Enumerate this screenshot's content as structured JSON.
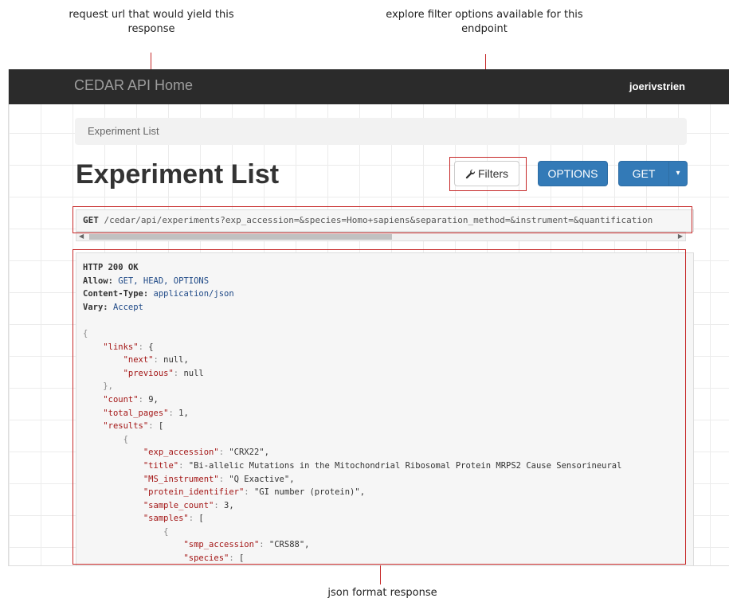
{
  "annotations": {
    "url_callout": "request url that would yield this response",
    "filters_callout": "explore filter options available for this endpoint",
    "json_callout": "json format response"
  },
  "navbar": {
    "brand": "CEDAR API Home",
    "user": "joerivstrien"
  },
  "breadcrumb": {
    "current": "Experiment List"
  },
  "page": {
    "title": "Experiment List"
  },
  "toolbar": {
    "filters_label": "Filters",
    "options_label": "OPTIONS",
    "get_label": "GET",
    "caret": "▾"
  },
  "request": {
    "method": "GET",
    "url": "/cedar/api/experiments?exp_accession=&species=Homo+sapiens&separation_method=&instrument=&quantification"
  },
  "response": {
    "status": "HTTP 200 OK",
    "headers": [
      {
        "name": "Allow:",
        "value": "GET, HEAD, OPTIONS"
      },
      {
        "name": "Content-Type:",
        "value": "application/json"
      },
      {
        "name": "Vary:",
        "value": "Accept"
      }
    ],
    "body_lines": [
      "{",
      "    \"links\": {",
      "        \"next\": null,",
      "        \"previous\": null",
      "    },",
      "    \"count\": 9,",
      "    \"total_pages\": 1,",
      "    \"results\": [",
      "        {",
      "            \"exp_accession\": \"CRX22\",",
      "            \"title\": \"Bi-allelic Mutations in the Mitochondrial Ribosomal Protein MRPS2 Cause Sensorineural",
      "            \"MS_instrument\": \"Q Exactive\",",
      "            \"protein_identifier\": \"GI number (protein)\",",
      "            \"sample_count\": 3,",
      "            \"samples\": [",
      "                {",
      "                    \"smp_accession\": \"CRS88\",",
      "                    \"species\": ["
    ]
  },
  "colors": {
    "navbar_bg": "#2b2b2b",
    "primary": "#337ab7",
    "annotation_red": "#c62828"
  }
}
